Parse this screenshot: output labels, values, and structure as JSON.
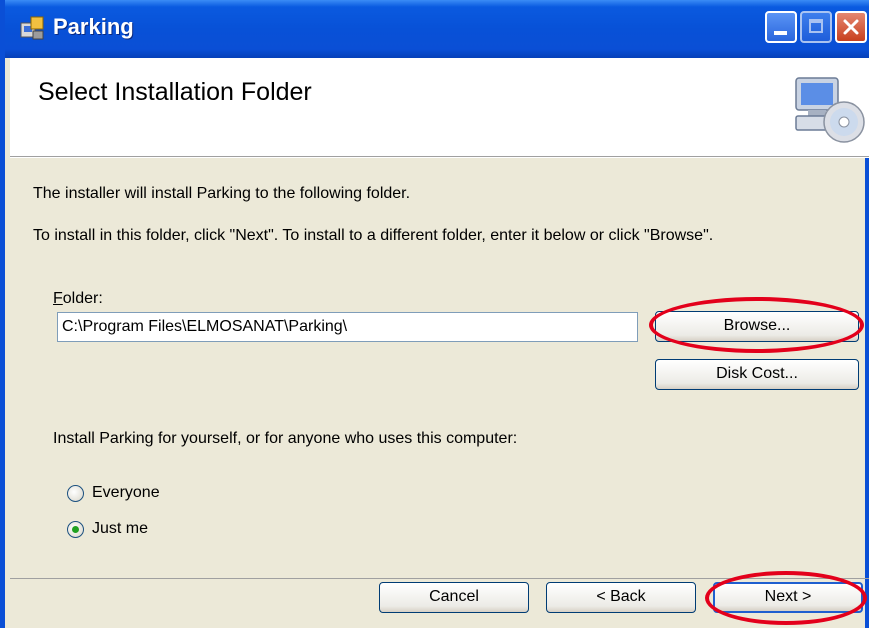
{
  "window": {
    "title": "Parking",
    "minimize_label": "Minimize",
    "maximize_label": "Maximize",
    "close_label": "Close"
  },
  "header": {
    "title": "Select Installation Folder"
  },
  "content": {
    "intro": "The installer will install Parking to the following folder.",
    "instructions": "To install in this folder, click \"Next\". To install to a different folder, enter it below or click \"Browse\".",
    "folder_label": "Folder:",
    "folder_value": "C:\\Program Files\\ELMOSANAT\\Parking\\",
    "browse_label": "Browse...",
    "disk_cost_label": "Disk Cost...",
    "install_for_text": "Install Parking for yourself, or for anyone who uses this computer:",
    "radio_everyone": "Everyone",
    "radio_just_me": "Just me",
    "selected_option": "Just me"
  },
  "footer": {
    "cancel_label": "Cancel",
    "back_label": "< Back",
    "next_label": "Next >"
  },
  "colors": {
    "titlebar": "#0a4fd6",
    "dialog_bg": "#ece9d8",
    "highlight_ellipse": "#e3001b"
  }
}
